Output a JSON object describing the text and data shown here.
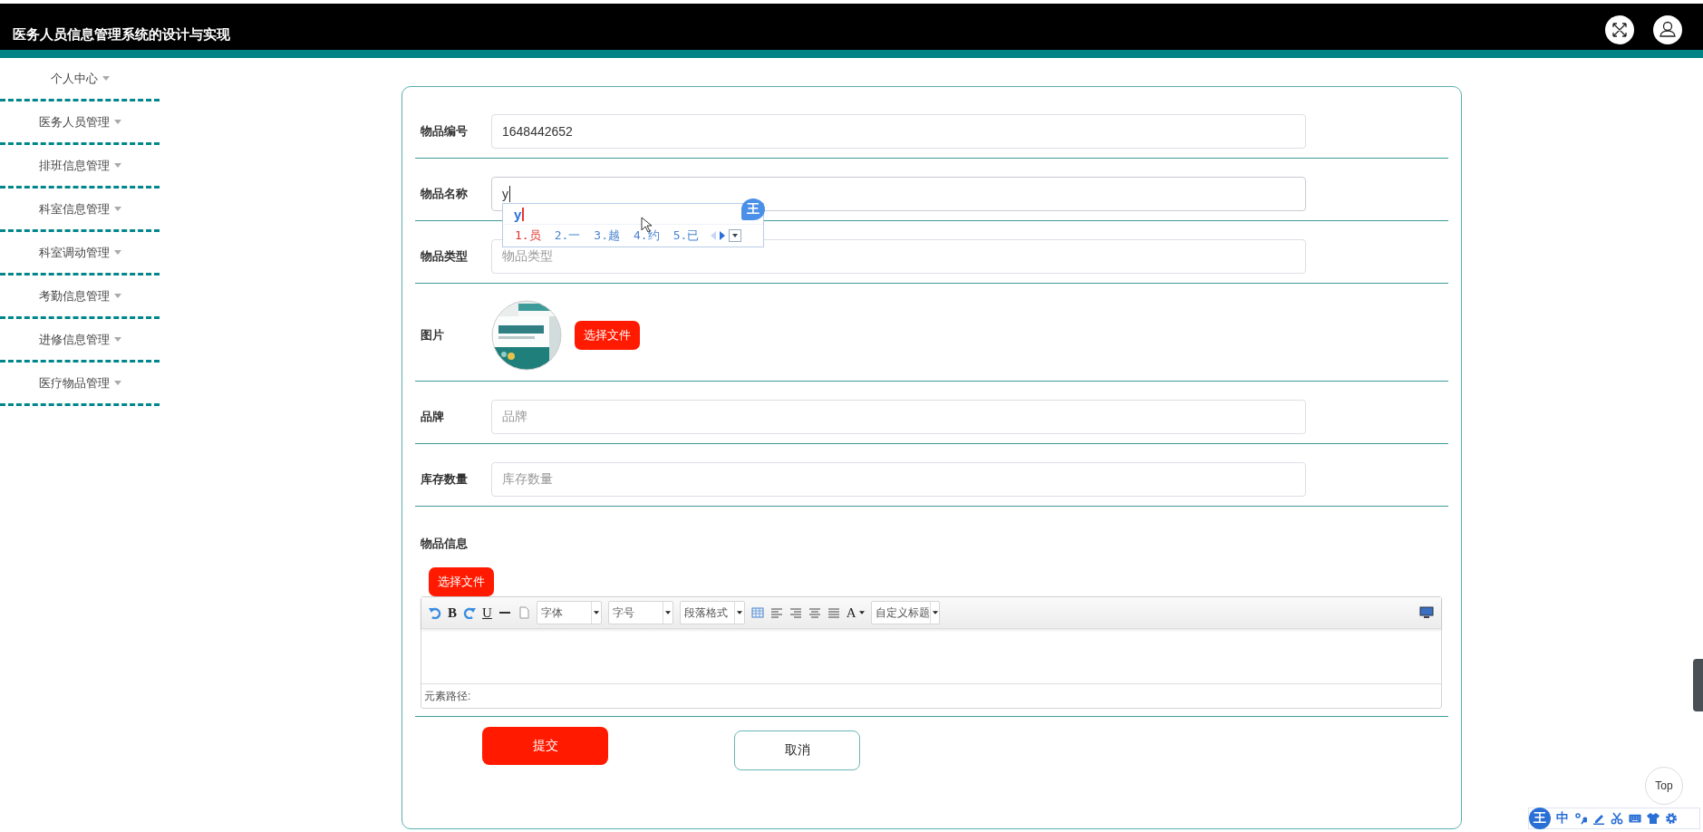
{
  "header": {
    "title": "医务人员信息管理系统的设计与实现"
  },
  "sidebar": {
    "items": [
      {
        "label": "个人中心"
      },
      {
        "label": "医务人员管理"
      },
      {
        "label": "排班信息管理"
      },
      {
        "label": "科室信息管理"
      },
      {
        "label": "科室调动管理"
      },
      {
        "label": "考勤信息管理"
      },
      {
        "label": "进修信息管理"
      },
      {
        "label": "医疗物品管理"
      }
    ]
  },
  "form": {
    "fields": [
      {
        "kind": "text",
        "label": "物品编号",
        "value": "1648442652",
        "focused": false
      },
      {
        "kind": "text",
        "label": "物品名称",
        "value": "y",
        "focused": true
      },
      {
        "kind": "text",
        "label": "物品类型",
        "placeholder": "物品类型",
        "focused": false
      },
      {
        "label": "图片",
        "button": "选择文件"
      },
      {
        "kind": "text",
        "label": "品牌",
        "placeholder": "品牌",
        "focused": false
      },
      {
        "kind": "text",
        "label": "库存数量",
        "placeholder": "库存数量",
        "focused": false
      },
      {
        "kind": "editor",
        "label": "物品信息",
        "button": "选择文件",
        "glyphs": [
          "B",
          "U",
          "A"
        ],
        "selects": [
          "字体",
          "字号",
          "段落格式"
        ],
        "heading_select": "自定义标题",
        "path_label": "元素路径:"
      }
    ],
    "submit": "提交",
    "cancel": "取消"
  },
  "ime": {
    "composition": "y",
    "logo": "王",
    "candidates": [
      {
        "text": "1.员",
        "selected": true
      },
      {
        "text": "2.一",
        "selected": false
      },
      {
        "text": "3.越",
        "selected": false
      },
      {
        "text": "4.约",
        "selected": false
      },
      {
        "text": "5.已",
        "selected": false
      }
    ]
  },
  "top_button": "Top",
  "ime_toolbar": {
    "logo": "王",
    "mode": "中"
  }
}
